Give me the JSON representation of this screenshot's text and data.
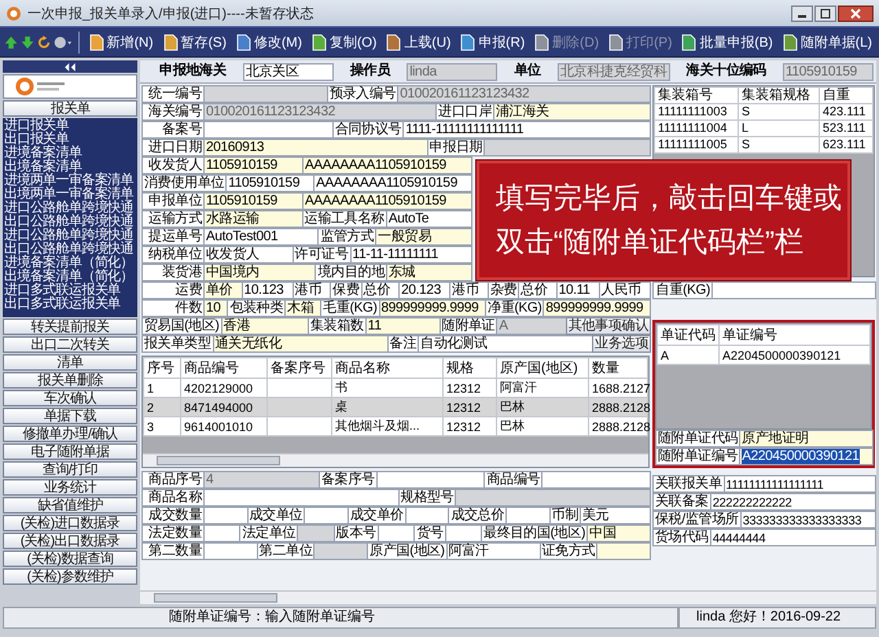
{
  "window": {
    "title": "一次申报_报关单录入/申报(进口)----未暂存状态"
  },
  "toolbar": {
    "buttons": [
      {
        "label": "新增(N)",
        "disabled": false
      },
      {
        "label": "暂存(S)",
        "disabled": false
      },
      {
        "label": "修改(M)",
        "disabled": false
      },
      {
        "label": "复制(O)",
        "disabled": false
      },
      {
        "label": "上载(U)",
        "disabled": false
      },
      {
        "label": "申报(R)",
        "disabled": false
      },
      {
        "label": "删除(D)",
        "disabled": true
      },
      {
        "label": "打印(P)",
        "disabled": true
      },
      {
        "label": "批量申报(B)",
        "disabled": false
      },
      {
        "label": "随附单据(L)",
        "disabled": false
      }
    ]
  },
  "sidebar": {
    "section": "报关单",
    "items": [
      "进口报关单",
      "出口报关单",
      "进境备案清单",
      "出境备案清单",
      "进境两单一审备案清单",
      "出境两单一审备案清单",
      "进口公路舱单跨境快通",
      "出口公路舱单跨境快通",
      "进口公路舱单跨境快通",
      "出口公路舱单跨境快通",
      "进境备案清单（简化）",
      "出境备案清单（简化）",
      "进口多式联运报关单",
      "出口多式联运报关单"
    ],
    "buttons": [
      "转关提前报关",
      "出口二次转关",
      "清单",
      "报关单删除",
      "车次确认",
      "单据下载",
      "修撤单办理/确认",
      "电子随附单据",
      "查询/打印",
      "业务统计",
      "缺省值维护",
      "(关检)进口数据录",
      "(关检)出口数据录",
      "(关检)数据查询",
      "(关检)参数维护"
    ]
  },
  "header": [
    {
      "kind": "label",
      "text": "申报地海关"
    },
    {
      "kind": "field",
      "text": "北京关区"
    },
    {
      "kind": "label",
      "text": "操作员"
    },
    {
      "kind": "readonly",
      "text": "linda"
    },
    {
      "kind": "label",
      "text": "单位"
    },
    {
      "kind": "readonly",
      "text": "北京科捷克经贸科"
    },
    {
      "kind": "label",
      "text": "海关十位编码"
    },
    {
      "kind": "readonly",
      "text": "1105910159"
    }
  ],
  "form": {
    "upper_rows": [
      [
        {
          "kind": "label",
          "text": "统一编号"
        },
        {
          "kind": "readonly"
        },
        {
          "kind": "label",
          "text": "预录入编号"
        },
        {
          "kind": "readonly",
          "text": "010020161123123432"
        }
      ],
      [
        {
          "kind": "label",
          "text": "海关编号"
        },
        {
          "kind": "readonly",
          "text": "010020161123123432"
        },
        {
          "kind": "label",
          "text": "进口口岸"
        },
        {
          "kind": "required",
          "text": "浦江海关"
        }
      ],
      [
        {
          "kind": "label",
          "text": "备案号"
        },
        {
          "kind": "field"
        },
        {
          "kind": "label",
          "text": "合同协议号"
        },
        {
          "kind": "field",
          "text": "1111-11111111111111"
        }
      ],
      [
        {
          "kind": "label",
          "text": "进口日期"
        },
        {
          "kind": "required",
          "text": "20160913"
        },
        {
          "kind": "label",
          "text": "申报日期"
        },
        {
          "kind": "readonly"
        }
      ]
    ],
    "rows_beside_note": [
      [
        {
          "kind": "label",
          "text": "收发货人"
        },
        {
          "kind": "required",
          "text": "1105910159"
        },
        {
          "kind": "required",
          "text": "AAAAAAAA1105910159"
        }
      ],
      [
        {
          "kind": "label",
          "text": "消费使用单位"
        },
        {
          "kind": "field",
          "text": "1105910159"
        },
        {
          "kind": "field",
          "text": "AAAAAAAA1105910159"
        }
      ],
      [
        {
          "kind": "label",
          "text": "申报单位"
        },
        {
          "kind": "required",
          "text": "1105910159"
        },
        {
          "kind": "required",
          "text": "AAAAAAAA1105910159"
        }
      ],
      [
        {
          "kind": "label",
          "text": "运输方式"
        },
        {
          "kind": "required",
          "text": "水路运输"
        },
        {
          "kind": "label",
          "text": "运输工具名称"
        },
        {
          "kind": "field",
          "text": "AutoTe"
        }
      ],
      [
        {
          "kind": "label",
          "text": "提运单号"
        },
        {
          "kind": "field",
          "text": "AutoTest001"
        },
        {
          "kind": "label",
          "text": "监管方式"
        },
        {
          "kind": "required",
          "text": "一般贸易"
        }
      ],
      [
        {
          "kind": "label",
          "text": "纳税单位"
        },
        {
          "kind": "field",
          "text": "收发货人"
        },
        {
          "kind": "label",
          "text": "许可证号"
        },
        {
          "kind": "field",
          "text": "11-11-11111111"
        }
      ],
      [
        {
          "kind": "label",
          "text": "装货港"
        },
        {
          "kind": "required",
          "text": "中国境内"
        },
        {
          "kind": "label",
          "text": "境内目的地"
        },
        {
          "kind": "required",
          "text": "东城"
        }
      ]
    ],
    "lower_rows": [
      [
        {
          "kind": "label",
          "text": "运费"
        },
        {
          "kind": "required",
          "text": "单价"
        },
        {
          "kind": "field",
          "text": "10.123"
        },
        {
          "kind": "field",
          "text": "港币"
        },
        {
          "kind": "label",
          "text": "保费"
        },
        {
          "kind": "field",
          "text": "总价"
        },
        {
          "kind": "field",
          "text": "20.123"
        },
        {
          "kind": "field",
          "text": "港币"
        },
        {
          "kind": "label",
          "text": "杂费"
        },
        {
          "kind": "field",
          "text": "总价"
        },
        {
          "kind": "field",
          "text": "10.11"
        },
        {
          "kind": "field",
          "text": "人民币"
        }
      ],
      [
        {
          "kind": "label",
          "text": "件数"
        },
        {
          "kind": "required",
          "text": "10"
        },
        {
          "kind": "label",
          "text": "包装种类"
        },
        {
          "kind": "required",
          "text": "木箱"
        },
        {
          "kind": "label",
          "text": "毛重(KG)"
        },
        {
          "kind": "required",
          "text": "899999999.9999"
        },
        {
          "kind": "label",
          "text": "净重(KG)"
        },
        {
          "kind": "required",
          "text": "899999999.9999"
        }
      ],
      [
        {
          "kind": "label",
          "text": "贸易国(地区)"
        },
        {
          "kind": "required",
          "text": "香港"
        },
        {
          "kind": "label",
          "text": "集装箱数"
        },
        {
          "kind": "required",
          "text": "11"
        },
        {
          "kind": "label",
          "text": "随附单证"
        },
        {
          "kind": "readonly",
          "text": "A"
        },
        {
          "kind": "button",
          "text": "其他事项确认"
        }
      ],
      [
        {
          "kind": "label",
          "text": "报关单类型"
        },
        {
          "kind": "required",
          "text": "通关无纸化"
        },
        {
          "kind": "label",
          "text": "备注"
        },
        {
          "kind": "field",
          "text": "自动化测试"
        },
        {
          "kind": "button",
          "text": "业务选项"
        }
      ]
    ]
  },
  "note": {
    "lines": [
      "填写完毕后，敲击回车键或",
      "双击“随附单证代码栏”栏"
    ]
  },
  "containers": {
    "columns": [
      "集装箱号",
      "集装箱规格",
      "自重"
    ],
    "rows": [
      [
        "11111111003",
        "S",
        "423.111"
      ],
      [
        "11111111004",
        "L",
        "523.111"
      ],
      [
        "11111111005",
        "S",
        "623.111"
      ]
    ],
    "weight_label": "自重(KG)"
  },
  "goods": {
    "columns": [
      "序号",
      "商品编号",
      "备案序号",
      "商品名称",
      "规格",
      "原产国(地区)",
      "数量"
    ],
    "rows": [
      {
        "cells": [
          "1",
          "4202129000",
          "",
          "书",
          "12312",
          "阿富汗",
          "1688.2127"
        ],
        "selected": false
      },
      {
        "cells": [
          "2",
          "8471494000",
          "",
          "桌",
          "12312",
          "巴林",
          "2888.2128"
        ],
        "selected": true
      },
      {
        "cells": [
          "3",
          "9614001010",
          "",
          "其他烟斗及烟...",
          "12312",
          "巴林",
          "2888.2128"
        ],
        "selected": false
      }
    ]
  },
  "attachments": {
    "columns": [
      "单证代码",
      "单证编号"
    ],
    "rows": [
      [
        "A",
        "A2204500000390121"
      ]
    ],
    "fields": [
      {
        "label": "随附单证代码",
        "value": "原产地证明",
        "text_selected": false
      },
      {
        "label": "随附单证编号",
        "value": "A220450000390121",
        "text_selected": true
      }
    ]
  },
  "goods_detail": [
    [
      {
        "kind": "label",
        "text": "商品序号"
      },
      {
        "kind": "readonly",
        "text": "4"
      },
      {
        "kind": "label",
        "text": "备案序号"
      },
      {
        "kind": "field"
      },
      {
        "kind": "label",
        "text": "商品编号"
      },
      {
        "kind": "field"
      }
    ],
    [
      {
        "kind": "label",
        "text": "商品名称"
      },
      {
        "kind": "field"
      },
      {
        "kind": "label",
        "text": "规格型号"
      },
      {
        "kind": "readonly"
      }
    ],
    [
      {
        "kind": "label",
        "text": "成交数量"
      },
      {
        "kind": "field"
      },
      {
        "kind": "label",
        "text": "成交单位"
      },
      {
        "kind": "field"
      },
      {
        "kind": "label",
        "text": "成交单价"
      },
      {
        "kind": "field"
      },
      {
        "kind": "label",
        "text": "成交总价"
      },
      {
        "kind": "field"
      },
      {
        "kind": "label",
        "text": "币制"
      },
      {
        "kind": "field",
        "text": "美元"
      }
    ],
    [
      {
        "kind": "label",
        "text": "法定数量"
      },
      {
        "kind": "field"
      },
      {
        "kind": "label",
        "text": "法定单位"
      },
      {
        "kind": "readonly"
      },
      {
        "kind": "label",
        "text": "版本号"
      },
      {
        "kind": "field"
      },
      {
        "kind": "label",
        "text": "货号"
      },
      {
        "kind": "field"
      },
      {
        "kind": "label",
        "text": "最终目的国(地区)"
      },
      {
        "kind": "required",
        "text": "中国"
      }
    ],
    [
      {
        "kind": "label",
        "text": "第二数量"
      },
      {
        "kind": "field"
      },
      {
        "kind": "label",
        "text": "第二单位"
      },
      {
        "kind": "readonly"
      },
      {
        "kind": "label",
        "text": "原产国(地区)"
      },
      {
        "kind": "field",
        "text": "阿富汗"
      },
      {
        "kind": "label",
        "text": "证免方式"
      },
      {
        "kind": "required"
      }
    ]
  ],
  "related": [
    {
      "label": "关联报关单",
      "value": "11111111111111111"
    },
    {
      "label": "关联备案",
      "value": "222222222222"
    },
    {
      "label": "保税/监管场所",
      "value": "333333333333333333"
    },
    {
      "label": "货场代码",
      "value": "44444444"
    }
  ],
  "status_bar": {
    "hint": "随附单证编号：输入随附单证编号",
    "user": "linda  您好！2016-09-22"
  }
}
